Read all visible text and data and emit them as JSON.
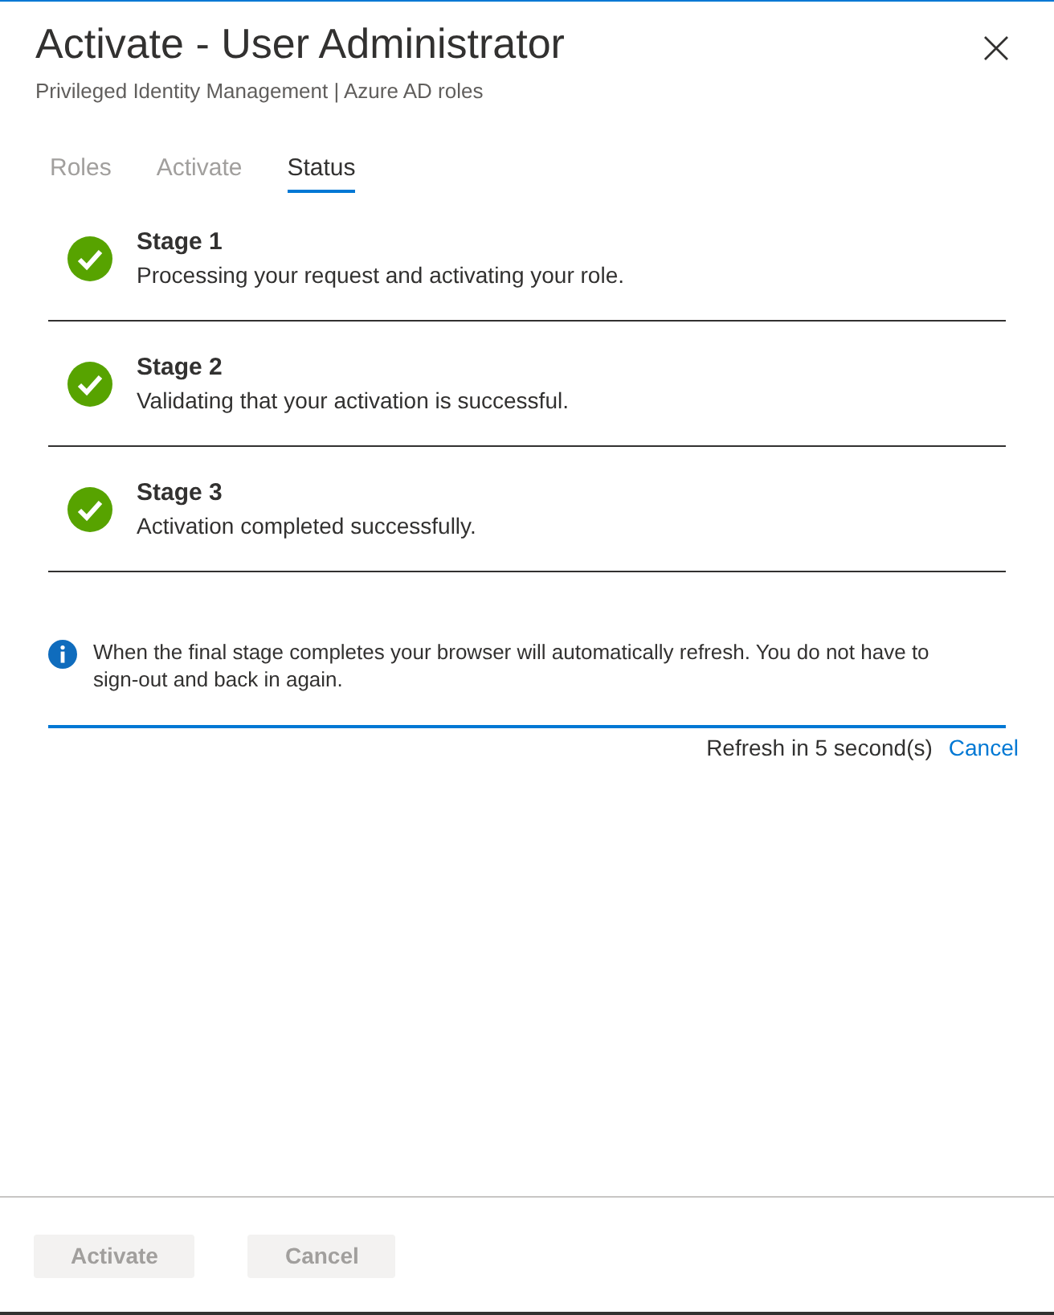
{
  "panel": {
    "title": "Activate - User Administrator",
    "subtitle": "Privileged Identity Management | Azure AD roles"
  },
  "tabs": [
    {
      "label": "Roles",
      "selected": false
    },
    {
      "label": "Activate",
      "selected": false
    },
    {
      "label": "Status",
      "selected": true
    }
  ],
  "stages": [
    {
      "title": "Stage 1",
      "description": "Processing your request and activating your role.",
      "completed": true
    },
    {
      "title": "Stage 2",
      "description": "Validating that your activation is successful.",
      "completed": true
    },
    {
      "title": "Stage 3",
      "description": "Activation completed successfully.",
      "completed": true
    }
  ],
  "info": {
    "message": "When the final stage completes your browser will automatically refresh. You do not have to sign-out and back in again."
  },
  "progress": {
    "level": 1,
    "countdown": "Refresh in 5 second(s)",
    "cancel_link": "Cancel"
  },
  "buttons": [
    {
      "label": "Activate",
      "disabled": true
    },
    {
      "label": "Cancel",
      "disabled": true
    }
  ]
}
